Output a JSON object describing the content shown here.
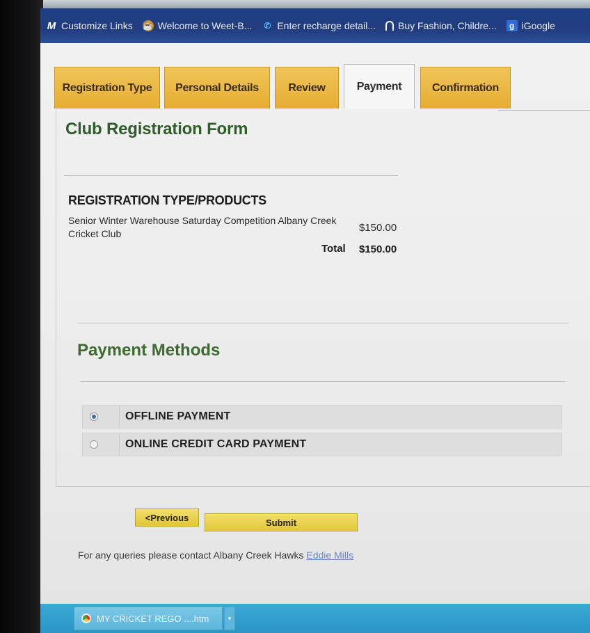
{
  "bookmarks": [
    {
      "icon": "gmail-m-icon",
      "label": "Customize Links"
    },
    {
      "icon": "cup-icon",
      "label": "Welcome to Weet-B..."
    },
    {
      "icon": "phone-icon",
      "label": "Enter recharge detail..."
    },
    {
      "icon": "shopping-bag-icon",
      "label": "Buy Fashion, Childre..."
    },
    {
      "icon": "igoogle-icon",
      "label": "iGoogle"
    }
  ],
  "bookmark_glyphs": {
    "m": "M",
    "cup": "☕",
    "phone": "✆",
    "shop": "",
    "g": "g"
  },
  "tabs": [
    "Registration Type",
    "Personal Details",
    "Review",
    "Payment",
    "Confirmation"
  ],
  "active_tab": "Payment",
  "form": {
    "title": "Club Registration Form",
    "products_heading": "REGISTRATION TYPE/PRODUCTS",
    "product_name": "Senior Winter Warehouse Saturday Competition Albany Creek Cricket Club",
    "product_price": "$150.00",
    "total_label": "Total",
    "total_value": "$150.00"
  },
  "payment": {
    "title": "Payment Methods",
    "options": [
      {
        "label": "OFFLINE PAYMENT",
        "selected": true
      },
      {
        "label": "ONLINE CREDIT CARD PAYMENT",
        "selected": false
      }
    ]
  },
  "buttons": {
    "previous": "<Previous",
    "submit": "Submit"
  },
  "footer": {
    "query_text": "For any queries please contact Albany Creek Hawks",
    "contact_link": "Eddie Mills"
  },
  "taskbar": {
    "item_label": "MY CRICKET REGO ....htm",
    "arrow": "▾"
  },
  "colors": {
    "tab": "#e6ad32",
    "title_green": "#2f5e2a",
    "button": "#e2c63a",
    "taskbar": "#2b95c6"
  }
}
